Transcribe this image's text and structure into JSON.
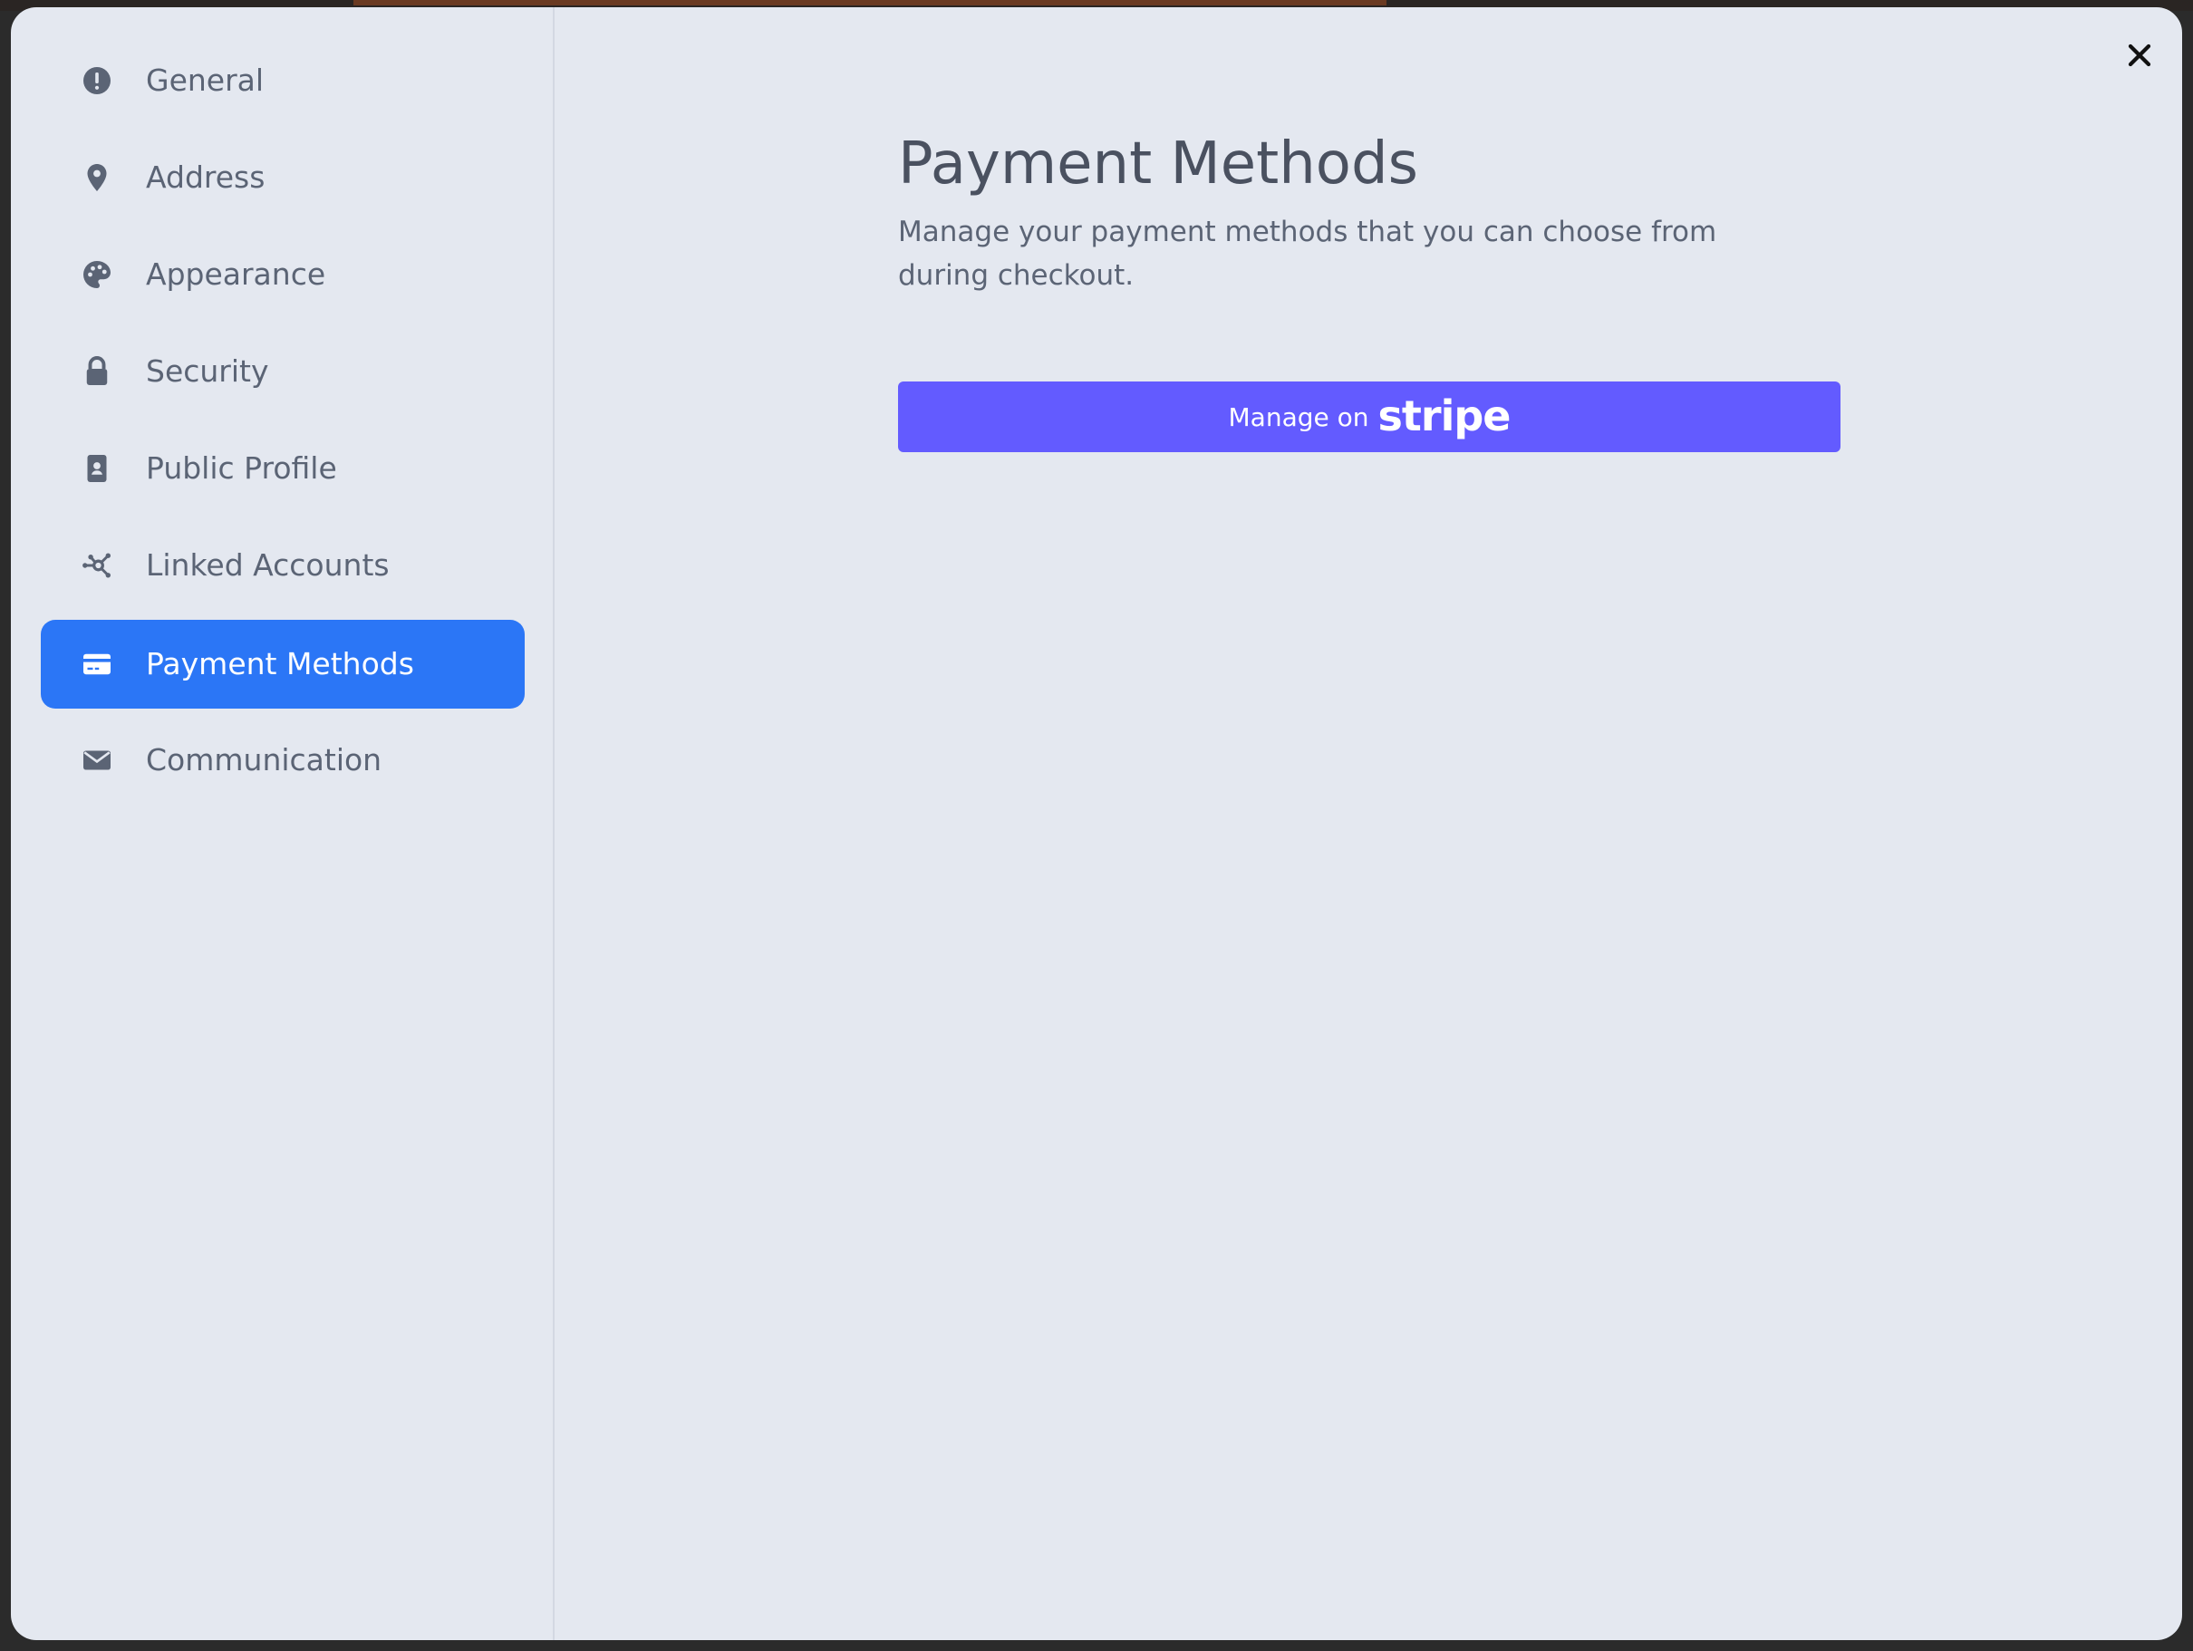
{
  "colors": {
    "accent": "#2b76f6",
    "stripe": "#635bff",
    "panel_bg": "#e4e8f0",
    "text": "#5b6475"
  },
  "sidebar": {
    "items": [
      {
        "label": "General",
        "icon": "exclamation-circle-icon",
        "active": false
      },
      {
        "label": "Address",
        "icon": "map-pin-icon",
        "active": false
      },
      {
        "label": "Appearance",
        "icon": "palette-icon",
        "active": false
      },
      {
        "label": "Security",
        "icon": "lock-icon",
        "active": false
      },
      {
        "label": "Public Profile",
        "icon": "id-badge-icon",
        "active": false
      },
      {
        "label": "Linked Accounts",
        "icon": "network-icon",
        "active": false
      },
      {
        "label": "Payment Methods",
        "icon": "credit-card-icon",
        "active": true
      },
      {
        "label": "Communication",
        "icon": "envelope-icon",
        "active": false
      }
    ]
  },
  "main": {
    "title": "Payment Methods",
    "description": "Manage your payment methods that you can choose from during checkout.",
    "button": {
      "prefix": "Manage on",
      "brand": "stripe"
    }
  },
  "close_icon": "close-icon"
}
